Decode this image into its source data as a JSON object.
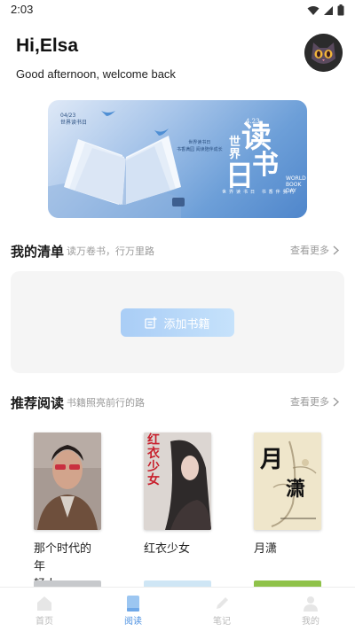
{
  "status_bar": {
    "time": "2:03"
  },
  "header": {
    "greeting": "Hi,Elsa",
    "welcome": "Good afternoon, welcome back"
  },
  "banner": {
    "date": "04/23",
    "date_sub": "世界读书日",
    "mini_line1": "世界读书日",
    "mini_line2": "书香满园 阅读陪伴成长",
    "big_dup": "4.23",
    "word_shi": "世",
    "word_jie": "界",
    "word_du": "读",
    "word_ri": "日",
    "word_shu": "书",
    "en_line1": "WORLD",
    "en_line2": "BOOK DAY",
    "bottom_line": "世界读书日 书香伴我行"
  },
  "my_list": {
    "title": "我的清单",
    "subtitle": "读万卷书，行万里路",
    "see_more": "查看更多",
    "add_button": "添加书籍"
  },
  "recommended": {
    "title": "推荐阅读",
    "subtitle": "书籍照亮前行的路",
    "see_more": "查看更多",
    "books": [
      {
        "title_line1": "那个时代的年",
        "title_line2": "轻人"
      },
      {
        "title_line1": "红衣少女",
        "cover_text": "红衣少女"
      },
      {
        "title_line1": "月潇",
        "cover_char1": "月",
        "cover_char2": "潇"
      }
    ]
  },
  "tabbar": {
    "tabs": [
      {
        "label": "首页",
        "icon": "home-icon"
      },
      {
        "label": "阅读",
        "icon": "book-icon"
      },
      {
        "label": "笔记",
        "icon": "pen-icon"
      },
      {
        "label": "我的",
        "icon": "user-icon"
      }
    ],
    "active_color": "#4a8fe0",
    "inactive_color": "#bbbbbb"
  }
}
